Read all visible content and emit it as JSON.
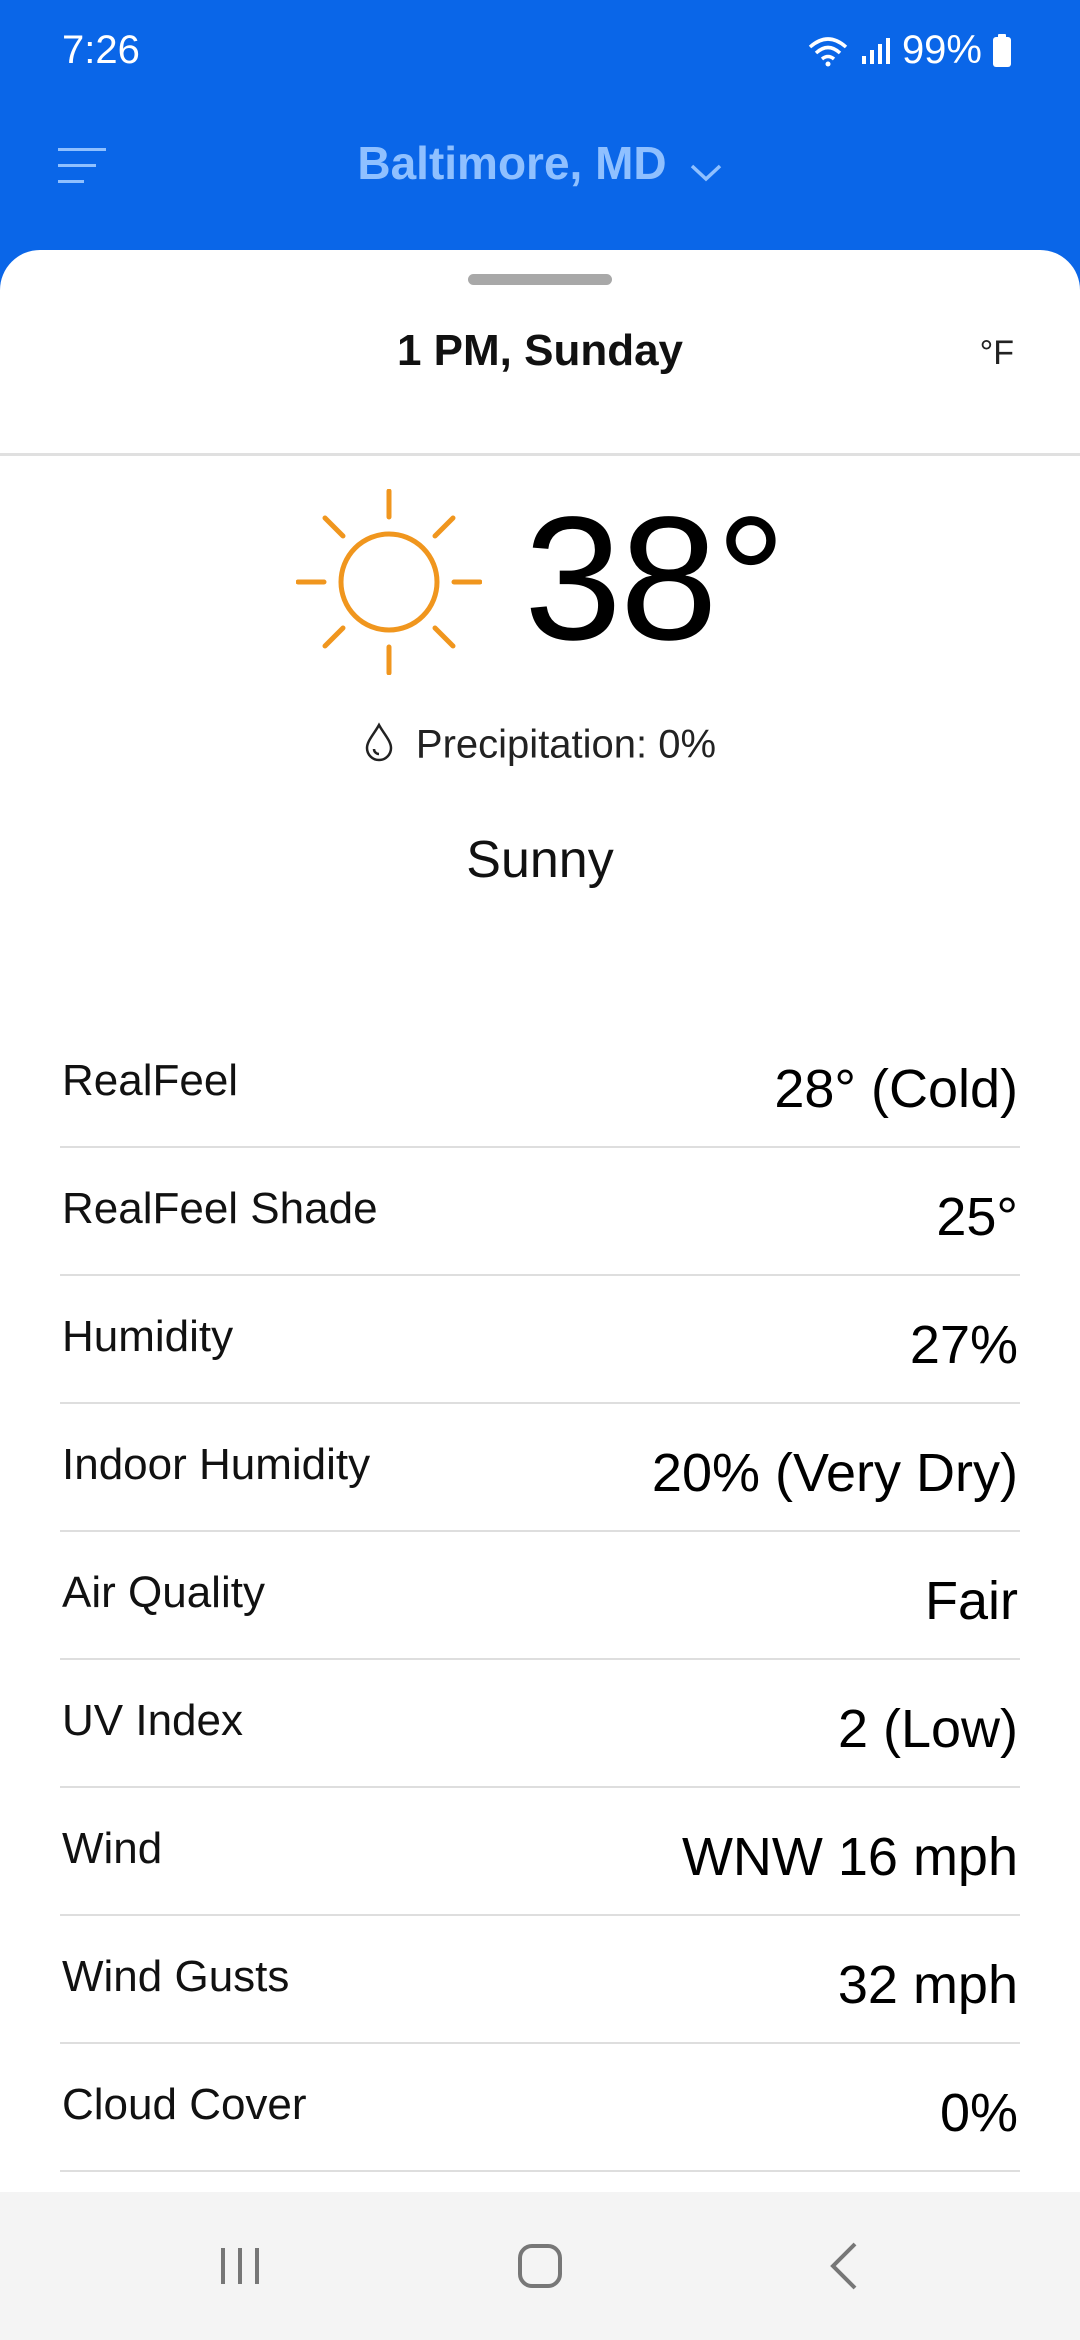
{
  "status_bar": {
    "time": "7:26",
    "battery": "99%"
  },
  "header": {
    "location": "Baltimore, MD"
  },
  "hourly": {
    "title": "1 PM, Sunday",
    "unit": "°F",
    "icon": "sun-icon",
    "temperature": "38°",
    "precipitation": "Precipitation: 0%",
    "phrase": "Sunny"
  },
  "details": [
    {
      "label": "RealFeel",
      "value": "28° (Cold)"
    },
    {
      "label": "RealFeel Shade",
      "value": "25°"
    },
    {
      "label": "Humidity",
      "value": "27%"
    },
    {
      "label": "Indoor Humidity",
      "value": "20% (Very Dry)"
    },
    {
      "label": "Air Quality",
      "value": "Fair"
    },
    {
      "label": "UV Index",
      "value": "2 (Low)"
    },
    {
      "label": "Wind",
      "value": "WNW 16 mph"
    },
    {
      "label": "Wind Gusts",
      "value": "32 mph"
    },
    {
      "label": "Cloud Cover",
      "value": "0%"
    }
  ],
  "colors": {
    "accent": "#0a66e8",
    "sun": "#f0961e"
  }
}
